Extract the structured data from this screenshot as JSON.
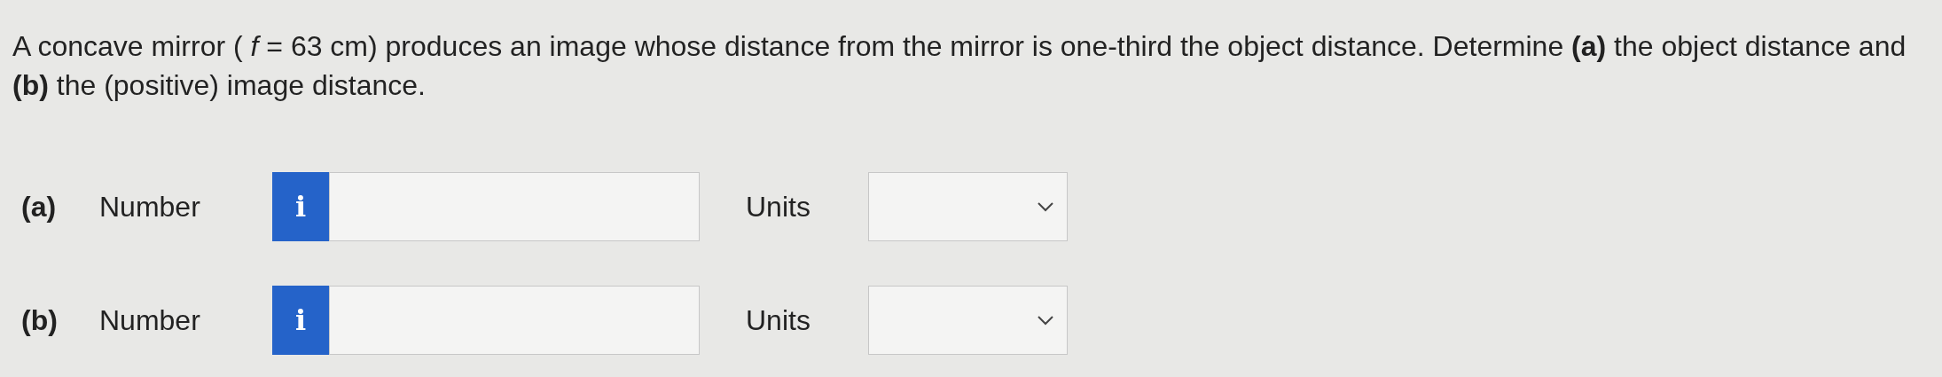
{
  "question": "A concave mirror ( *f* = 63 cm) produces an image whose distance from the mirror is one-third the object distance. Determine **(a)** the object distance and **(b)** the (positive) image distance.",
  "parts": [
    {
      "label": "(a)",
      "number_label": "Number",
      "info_button": "i",
      "units_label": "Units"
    },
    {
      "label": "(b)",
      "number_label": "Number",
      "info_button": "i",
      "units_label": "Units"
    }
  ]
}
